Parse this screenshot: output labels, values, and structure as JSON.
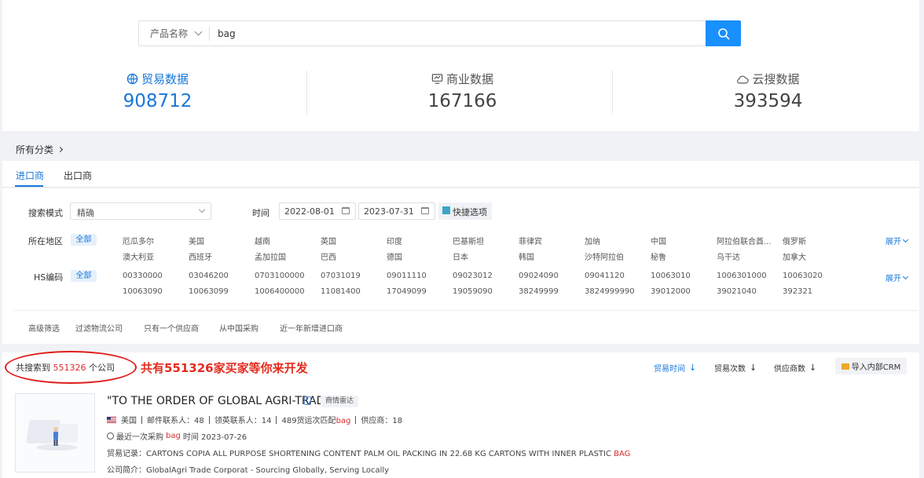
{
  "search": {
    "type_label": "产品名称",
    "query": "bag"
  },
  "stats": [
    {
      "label": "贸易数据",
      "value": "908712",
      "icon": "globe-icon"
    },
    {
      "label": "商业数据",
      "value": "167166",
      "icon": "monitor-icon"
    },
    {
      "label": "云搜数据",
      "value": "393594",
      "icon": "cloud-icon"
    }
  ],
  "breadcrumb": "所有分类",
  "tabs": [
    "进口商",
    "出口商"
  ],
  "filters": {
    "search_mode_label": "搜索模式",
    "search_mode_value": "精确",
    "time_label": "时间",
    "date_from": "2022-08-01",
    "date_to": "2023-07-31",
    "quick_option": "快捷选项",
    "region_label": "所在地区",
    "all_tag": "全部",
    "regions_row1": [
      "厄瓜多尔",
      "美国",
      "越南",
      "英国",
      "印度",
      "巴基斯坦",
      "菲律宾",
      "加纳",
      "中国",
      "阿拉伯联合酋...",
      "俄罗斯"
    ],
    "regions_row2": [
      "澳大利亚",
      "西班牙",
      "孟加拉国",
      "巴西",
      "德国",
      "日本",
      "韩国",
      "沙特阿拉伯",
      "秘鲁",
      "乌干达",
      "加拿大"
    ],
    "hs_label": "HS编码",
    "hs_row1": [
      "00330000",
      "03046200",
      "0703100000",
      "07031019",
      "09011110",
      "09023012",
      "09024090",
      "09041120",
      "10063010",
      "1006301000",
      "10063020"
    ],
    "hs_row2": [
      "10063090",
      "10063099",
      "1006400000",
      "11081400",
      "17049099",
      "19059090",
      "38249999",
      "3824999990",
      "39012000",
      "39021040",
      "392321"
    ],
    "expand_label": "展开",
    "advanced_label": "高级筛选",
    "advanced_options": [
      "过滤物流公司",
      "只有一个供应商",
      "从中国采购",
      "近一年新增进口商"
    ]
  },
  "results": {
    "count_prefix": "共搜索到",
    "count": "551326",
    "count_suffix": "个公司",
    "promo": "共有551326家买家等你来开发",
    "sort_options": [
      "贸易时间",
      "贸易次数",
      "供应商数"
    ],
    "crm_button": "导入内部CRM"
  },
  "company": {
    "name": "\"TO THE ORDER OF GLOBAL AGRI-TRADE\"",
    "radar_label": "商情雷达",
    "country": "美国",
    "email_contacts": "邮件联系人：48",
    "linkedin_contacts": "领英联系人：14",
    "shipments_prefix": "489货运次匹配",
    "keyword": "bag",
    "suppliers": "供应商：18",
    "last_purchase_prefix": "最近一次采购",
    "last_purchase_suffix": "时间 2023-07-26",
    "trade_record_label": "贸易记录：",
    "trade_record": "CARTONS COPIA ALL PURPOSE SHORTENING CONTENT PALM OIL PACKING IN 22.68 KG CARTONS WITH INNER PLASTIC",
    "trade_record_keyword": "BAG",
    "desc_label": "公司简介：",
    "desc": "GlobalAgri Trade Corporat - Sourcing Globally, Serving Locally"
  },
  "colors": {
    "accent": "#1877d9",
    "search_button": "#1890ff",
    "highlight_red": "#d92b2b",
    "annotation_red": "#e52b1f"
  }
}
